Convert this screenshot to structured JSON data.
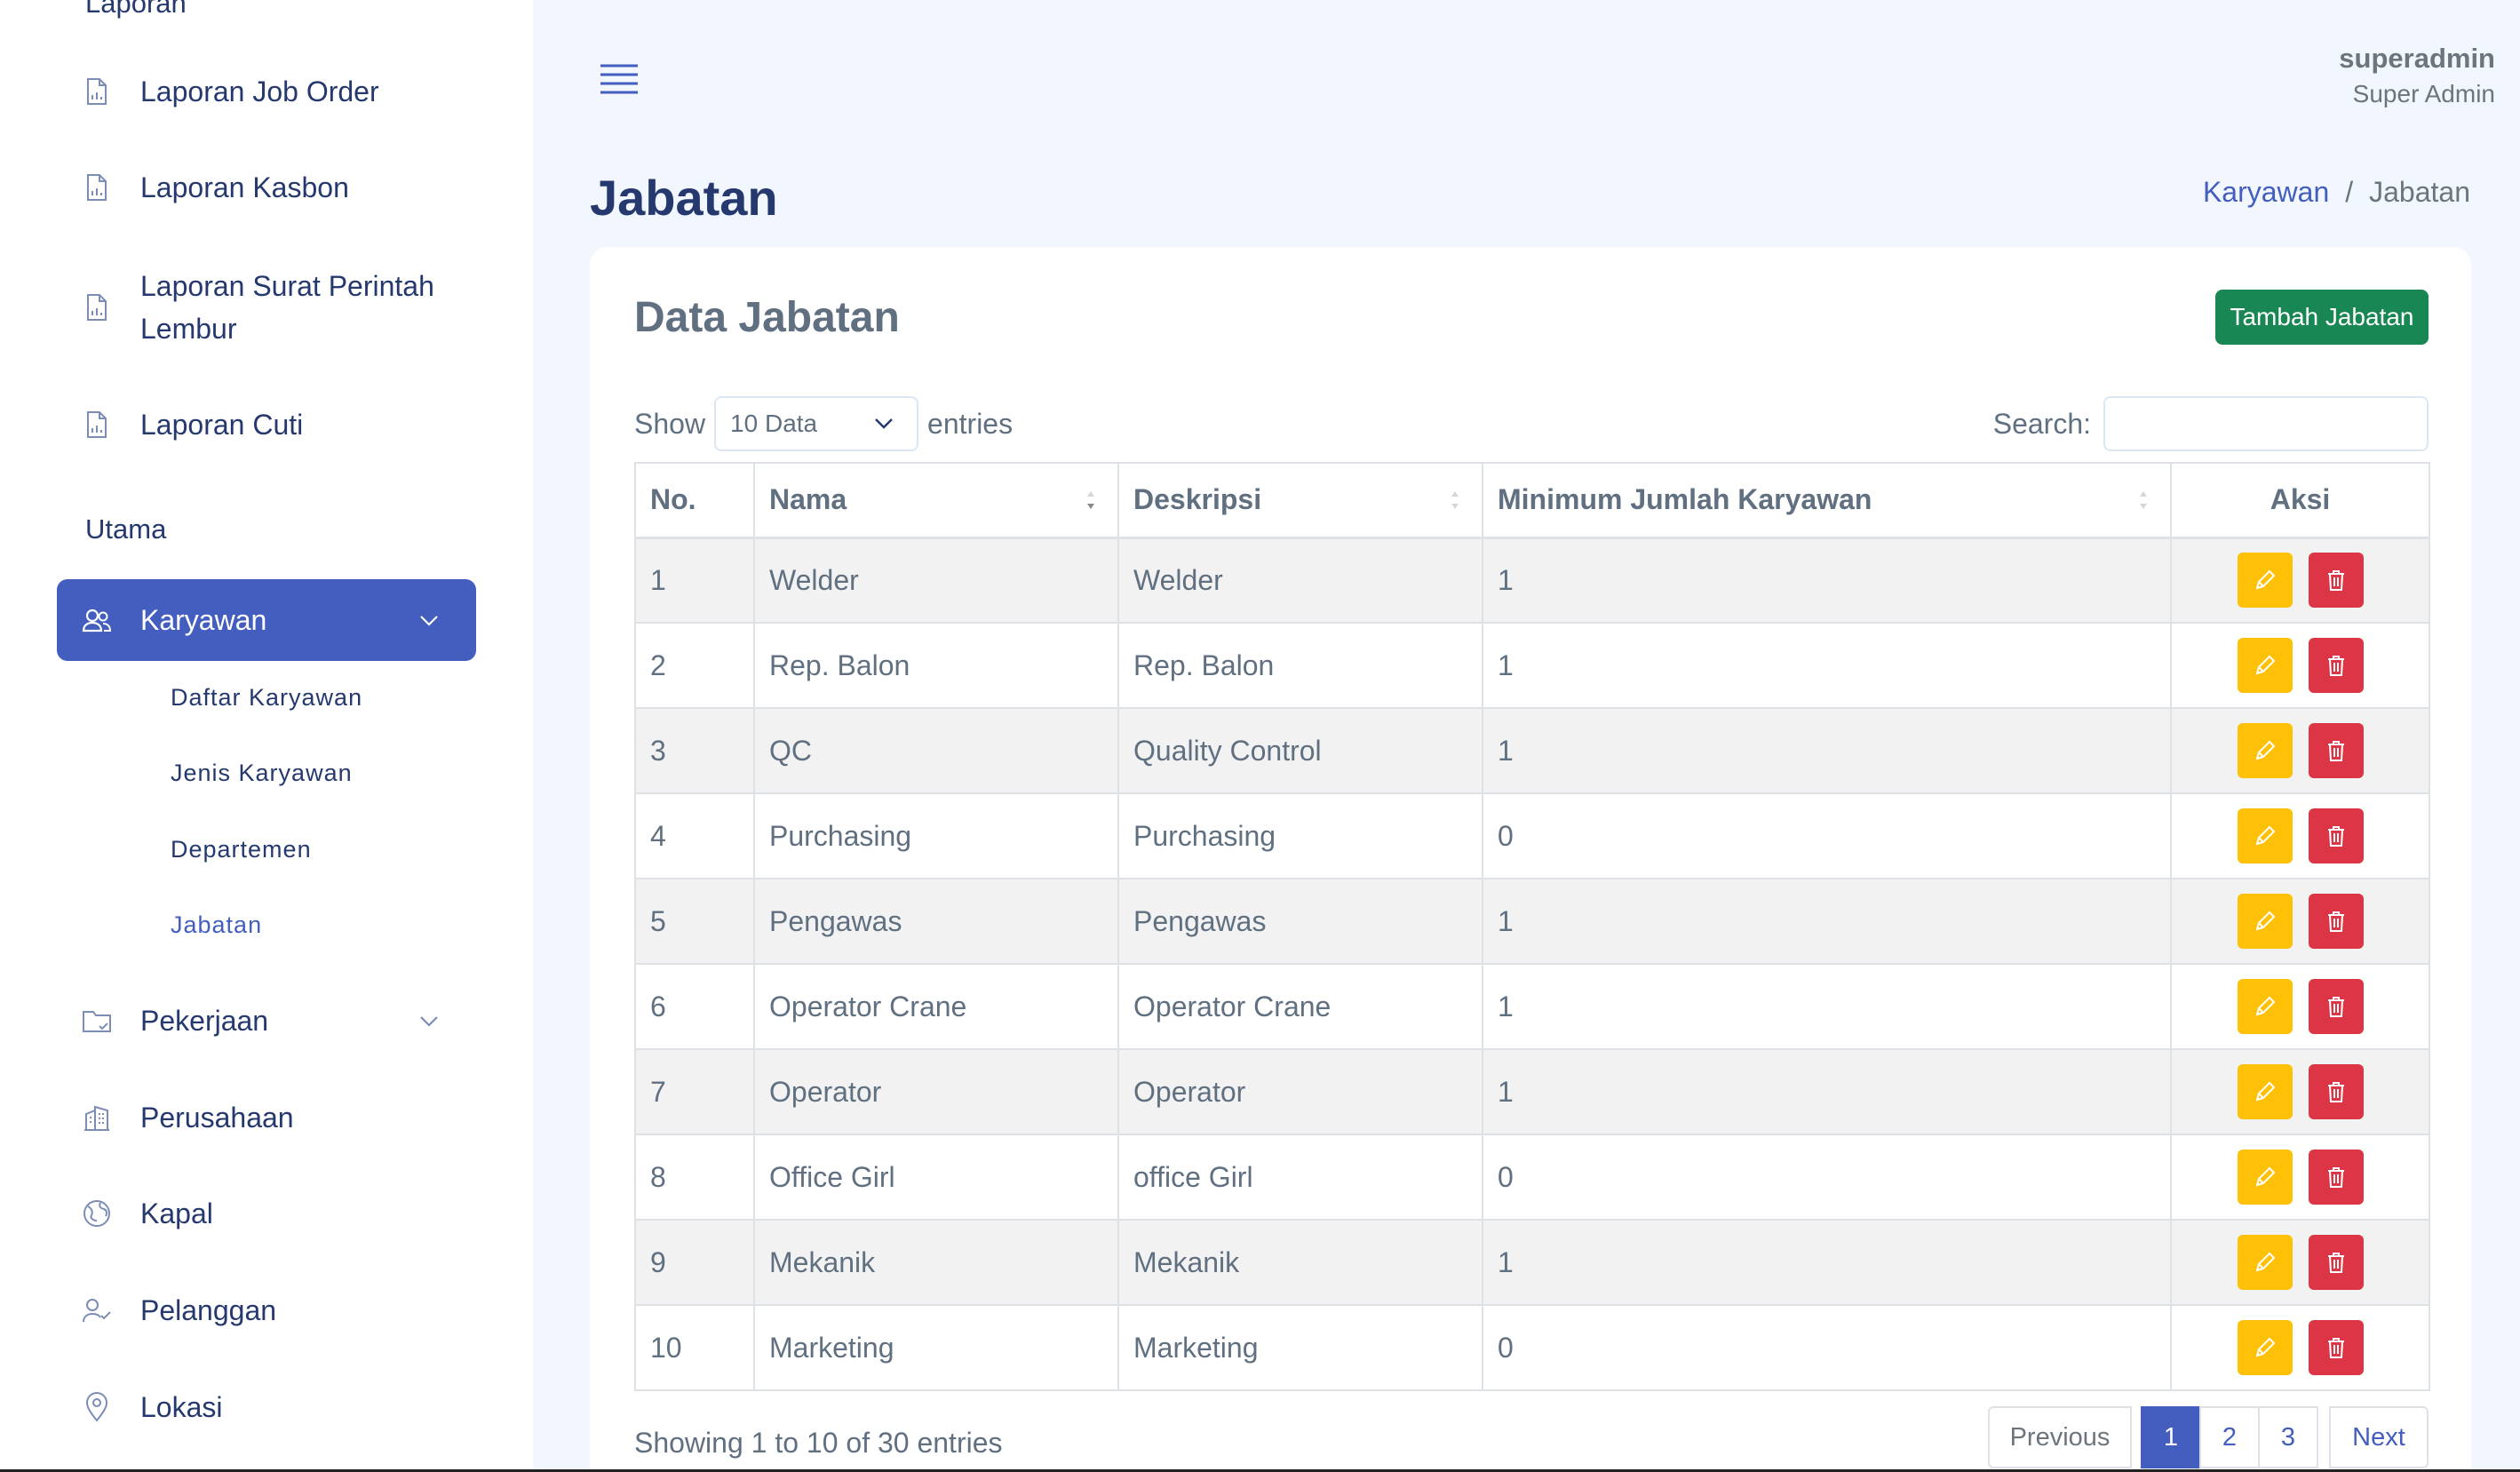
{
  "sidebar": {
    "section_laporan": "Laporan",
    "laporan_items": [
      {
        "label": "Laporan Job Order",
        "icon": "report-icon"
      },
      {
        "label": "Laporan Kasbon",
        "icon": "report-icon"
      },
      {
        "label": "Laporan Surat Perintah Lembur",
        "icon": "report-icon"
      },
      {
        "label": "Laporan Cuti",
        "icon": "report-icon"
      }
    ],
    "section_utama": "Utama",
    "karyawan": {
      "label": "Karyawan",
      "icon": "people-icon",
      "active": true
    },
    "karyawan_sub": [
      {
        "label": "Daftar Karyawan"
      },
      {
        "label": "Jenis Karyawan"
      },
      {
        "label": "Departemen"
      },
      {
        "label": "Jabatan",
        "active": true
      }
    ],
    "other_items": [
      {
        "label": "Pekerjaan",
        "icon": "folder-icon"
      },
      {
        "label": "Perusahaan",
        "icon": "building-icon"
      },
      {
        "label": "Kapal",
        "icon": "globe-icon"
      },
      {
        "label": "Pelanggan",
        "icon": "person-check-icon"
      },
      {
        "label": "Lokasi",
        "icon": "location-pin-icon"
      }
    ]
  },
  "header": {
    "user_name": "superadmin",
    "user_role": "Super Admin"
  },
  "page": {
    "title": "Jabatan",
    "breadcrumb": {
      "parent": "Karyawan",
      "separator": "/",
      "current": "Jabatan"
    }
  },
  "card": {
    "title": "Data Jabatan",
    "add_button": "Tambah Jabatan",
    "show_label": "Show",
    "entries_select": "10 Data",
    "entries_label": "entries",
    "search_label": "Search:"
  },
  "table": {
    "headers": [
      "No.",
      "Nama",
      "Deskripsi",
      "Minimum Jumlah Karyawan",
      "Aksi"
    ],
    "rows": [
      {
        "no": "1",
        "nama": "Welder",
        "deskripsi": "Welder",
        "min": "1"
      },
      {
        "no": "2",
        "nama": "Rep. Balon",
        "deskripsi": "Rep. Balon",
        "min": "1"
      },
      {
        "no": "3",
        "nama": "QC",
        "deskripsi": "Quality Control",
        "min": "1"
      },
      {
        "no": "4",
        "nama": "Purchasing",
        "deskripsi": "Purchasing",
        "min": "0"
      },
      {
        "no": "5",
        "nama": "Pengawas",
        "deskripsi": "Pengawas",
        "min": "1"
      },
      {
        "no": "6",
        "nama": "Operator Crane",
        "deskripsi": "Operator Crane",
        "min": "1"
      },
      {
        "no": "7",
        "nama": "Operator",
        "deskripsi": "Operator",
        "min": "1"
      },
      {
        "no": "8",
        "nama": "Office Girl",
        "deskripsi": "office Girl",
        "min": "0"
      },
      {
        "no": "9",
        "nama": "Mekanik",
        "deskripsi": "Mekanik",
        "min": "1"
      },
      {
        "no": "10",
        "nama": "Marketing",
        "deskripsi": "Marketing",
        "min": "0"
      }
    ]
  },
  "footer": {
    "info": "Showing 1 to 10 of 30 entries",
    "previous": "Previous",
    "pages": [
      "1",
      "2",
      "3"
    ],
    "next": "Next"
  },
  "colors": {
    "primary": "#435ebe",
    "success": "#198754",
    "warning": "#ffc107",
    "danger": "#dc3545"
  }
}
